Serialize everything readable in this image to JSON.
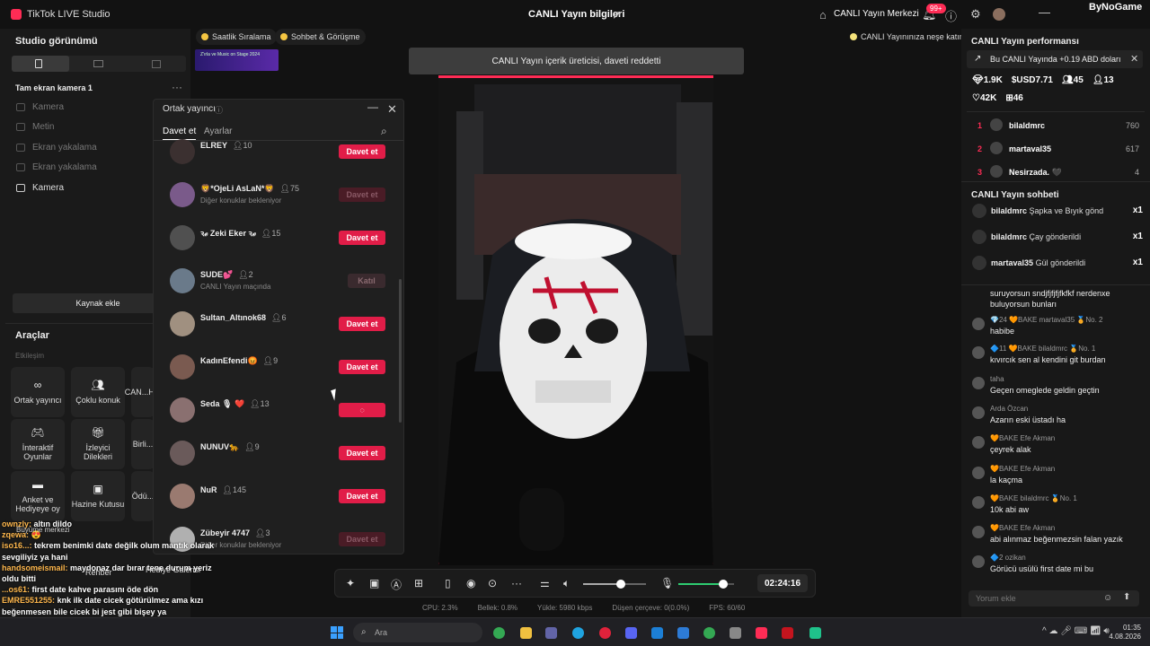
{
  "app": {
    "title": "TikTok LIVE Studio",
    "center_title": "CANLI Yayın bilgileri",
    "live_center": "CANLI Yayın Merkezi",
    "notif_count": "99+",
    "watermark": "ByNoGame"
  },
  "left": {
    "studio_view": "Studio görünümü",
    "scene": "Tam ekran kamera 1",
    "sources": [
      "Kamera",
      "Metin",
      "Ekran yakalama",
      "Ekran yakalama",
      "Kamera"
    ],
    "add_source": "Kaynak ekle",
    "tools_title": "Araçlar",
    "interaction": "Etkileşim",
    "tools": [
      "Ortak yayıncı",
      "Çoklu konuk",
      "CAN...H...",
      "İnteraktif Oyunlar",
      "İzleyici Dilekleri",
      "Birli...",
      "Anket ve Hediyeye oy",
      "Hazine Kutusu",
      "Ödü...",
      "Büyüme merkezi",
      "Rehber",
      "Hediye Galerisi",
      "Ayarlar Kulübü"
    ]
  },
  "top": {
    "pill_ranking": "Saatlik Sıralama",
    "pill_chat": "Sohbet & Görüşme",
    "hint": "CANLI Yayınınıza neşe katın",
    "banner_text": "Z'ırla ve Music on Stage 2024"
  },
  "toast": "CANLI Yayın içerik üreticisi, daveti reddetti",
  "cohost": {
    "title": "Ortak yayıncı",
    "tab_invite": "Davet et",
    "tab_settings": "Ayarlar",
    "users": [
      {
        "name": "ELREY",
        "count": "10",
        "sub": "",
        "btn": "Davet et",
        "state": "active"
      },
      {
        "name": "🦁*OjeLi AsLaN*🦁",
        "count": "75",
        "sub": "Diğer konuklar bekleniyor",
        "btn": "Davet et",
        "state": "disabled"
      },
      {
        "name": "ꝛℯ Zeki Eker ꝛℯ",
        "count": "15",
        "sub": "",
        "btn": "Davet et",
        "state": "active"
      },
      {
        "name": "SUDE💕",
        "count": "2",
        "sub": "CANLI Yayın maçında",
        "btn": "Katıl",
        "state": "join"
      },
      {
        "name": "Sultan_Altınok68",
        "count": "6",
        "sub": "",
        "btn": "Davet et",
        "state": "active"
      },
      {
        "name": "KadınEfendi😡",
        "count": "9",
        "sub": "",
        "btn": "Davet et",
        "state": "active"
      },
      {
        "name": "Seda 🎙 ❤️",
        "count": "13",
        "sub": "",
        "btn": "◌",
        "state": "active"
      },
      {
        "name": "NUNUV🐆",
        "count": "9",
        "sub": "",
        "btn": "Davet et",
        "state": "active"
      },
      {
        "name": "NuR",
        "count": "145",
        "sub": "",
        "btn": "Davet et",
        "state": "active"
      },
      {
        "name": "Zübeyir 4747",
        "count": "3",
        "sub": "Diğer konuklar bekleniyor",
        "btn": "Davet et",
        "state": "disabled"
      }
    ]
  },
  "controls": {
    "timer": "02:24:16",
    "volume_level": 0.6,
    "mic_level": 0.8
  },
  "stats": {
    "cpu": "CPU: 2.3%",
    "mem": "Bellek: 0.8%",
    "upload": "Yükle: 5980 kbps",
    "drop": "Düşen çerçeve: 0(0.0%)",
    "fps": "FPS: 60/60"
  },
  "right": {
    "perf_title": "CANLI Yayın performansı",
    "perf_note": "Bu CANLI Yayında +0.19 ABD doları",
    "stats1": [
      "1.9K",
      "USD7.71",
      "45",
      "13"
    ],
    "stats2": [
      "42K",
      "46"
    ],
    "ranks": [
      {
        "n": "1",
        "u": "bilaldmrc",
        "v": "760"
      },
      {
        "n": "2",
        "u": "martaval35",
        "v": "617"
      },
      {
        "n": "3",
        "u": "Nesirzada. 🖤",
        "v": "4"
      }
    ],
    "chat_title": "CANLI Yayın sohbeti",
    "gifts": [
      {
        "u": "bilaldmrc",
        "t": "Şapka ve Bıyık gönd",
        "x": "x1"
      },
      {
        "u": "bilaldmrc",
        "t": "Çay gönderildi",
        "x": "x1"
      },
      {
        "u": "martaval35",
        "t": "Gül gönderildi",
        "x": "x1"
      }
    ],
    "chat": [
      {
        "h": "",
        "m": "suruyorsun sndjfjfjfjfkfkf nerdenxe",
        "m2": "buluyorsun bunları"
      },
      {
        "h": "💎24 🧡BAKE martaval35 🏅No. 2",
        "m": "habibe"
      },
      {
        "h": "🔷11 🧡BAKE bilaldmrc 🏅No. 1",
        "m": "kıvırcık sen al kendini git burdan"
      },
      {
        "h": "taha",
        "m": "Geçen omeglede geldin geçtin"
      },
      {
        "h": "Arda Özcan",
        "m": "Azarın eski üstadı ha"
      },
      {
        "h": "🧡BAKE Efe Akman",
        "m": "çeyrek alak"
      },
      {
        "h": "🧡BAKE Efe Akman",
        "m": "la kaçma"
      },
      {
        "h": "🧡BAKE bilaldmrc 🏅No. 1",
        "m": "10k abi aw"
      },
      {
        "h": "🧡BAKE Efe Akman",
        "m": "abi alınmaz beğenmezsin falan yazık"
      },
      {
        "h": "🔷2 ozikan",
        "m": "Görücü usülü first date mi bu"
      }
    ],
    "comment_placeholder": "Yorum ekle"
  },
  "overlay_chat": [
    {
      "u": "ownzly:",
      "m": "altın dildo"
    },
    {
      "u": "zqewa:",
      "m": "😍"
    },
    {
      "u": "iso16...:",
      "m": "tekrem benimki date değilk olum mantık olarak"
    },
    {
      "u": "",
      "m": "sevgiliyiz ya hani"
    },
    {
      "u": "handsomeismail:",
      "m": "maydonaz dar bırar tene durum yeriz"
    },
    {
      "u": "",
      "m": "oldu bitti"
    },
    {
      "u": "...os61:",
      "m": "first date kahve parasını öde dön"
    },
    {
      "u": "EMRE551255:",
      "m": "knk ilk date cicek götürülmez ama kızı"
    },
    {
      "u": "",
      "m": "beğenmesen bile cicek bi jest gibi bişey ya"
    }
  ],
  "taskbar": {
    "search": "Ara",
    "time": "01:35",
    "date": "4.08.2026"
  }
}
